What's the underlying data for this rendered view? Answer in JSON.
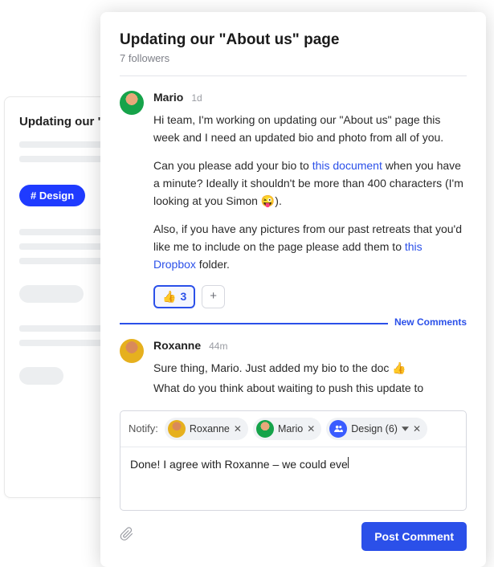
{
  "background": {
    "truncated_title": "Updating our \"A",
    "chip": "# Design"
  },
  "post": {
    "title": "Updating our \"About us\" page",
    "followers": "7 followers"
  },
  "comments": [
    {
      "author": "Mario",
      "timestamp": "1d",
      "para1a": "Hi team, I'm working on updating our \"About us\" page this week and I need an updated bio and photo from all of you.",
      "para2a": "Can you please add your bio to ",
      "link1": "this document",
      "para2b": " when you have a minute? Ideally it shouldn't be more than 400 characters (I'm looking at you Simon 😜).",
      "para3a": "Also, if you have any pictures from our past retreats that you'd like me to include on the page please add them to ",
      "link2": "this Dropbox",
      "para3b": " folder.",
      "reaction_emoji": "👍",
      "reaction_count": "3",
      "add_label": "+"
    },
    {
      "author": "Roxanne",
      "timestamp": "44m",
      "line1a": "Sure thing, Mario. Just added my bio to the doc ",
      "line1_emoji": "👍",
      "line2": "What do you think about waiting to push this update to"
    }
  ],
  "divider": {
    "label": "New Comments"
  },
  "compose": {
    "notify_label": "Notify:",
    "recipients": [
      {
        "label": "Roxanne"
      },
      {
        "label": "Mario"
      },
      {
        "label": "Design (6)"
      }
    ],
    "draft": "Done! I agree with Roxanne – we could eve",
    "submit": "Post Comment"
  }
}
